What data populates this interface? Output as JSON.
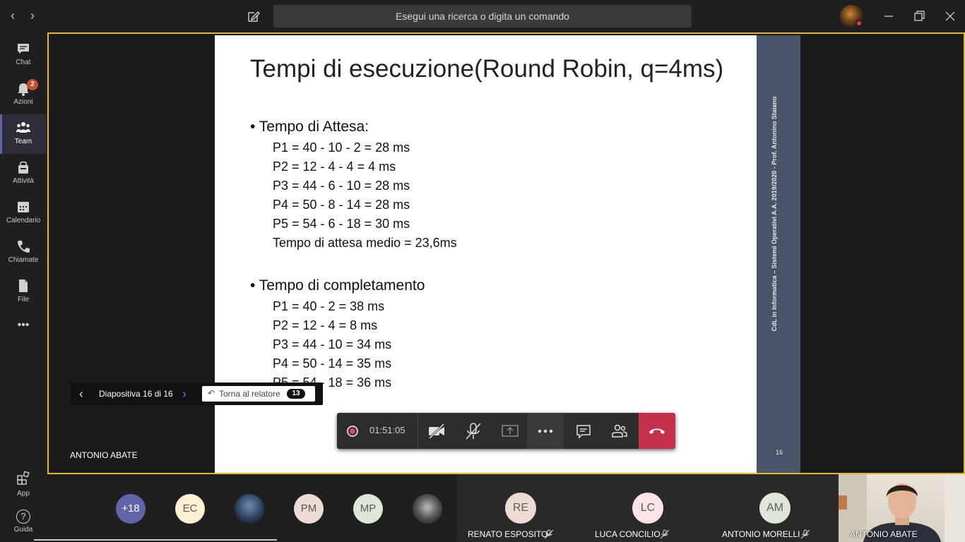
{
  "titlebar": {
    "search_placeholder": "Esegui una ricerca o digita un comando"
  },
  "rail": {
    "items": [
      {
        "label": "Chat",
        "icon": "chat-icon"
      },
      {
        "label": "Azioni",
        "icon": "bell-icon",
        "badge": "2"
      },
      {
        "label": "Team",
        "icon": "teams-icon"
      },
      {
        "label": "Attività",
        "icon": "bag-icon"
      },
      {
        "label": "Calendario",
        "icon": "calendar-icon"
      },
      {
        "label": "Chiamate",
        "icon": "phone-icon"
      },
      {
        "label": "File",
        "icon": "file-icon"
      }
    ],
    "more": "•••",
    "app_label": "App",
    "help_label": "Guida",
    "help_glyph": "?"
  },
  "slide": {
    "title": "Tempi di esecuzione(Round Robin, q=4ms)",
    "section1": "• Tempo di Attesa:",
    "wait_lines": [
      "P1 = 40 - 10 - 2 = 28 ms",
      "P2 = 12 - 4 -  4 = 4 ms",
      "P3 = 44 - 6 - 10 = 28 ms",
      "P4 = 50 - 8 - 14 = 28 ms",
      "P5 = 54 - 6 - 18 = 30 ms",
      "Tempo di attesa medio = 23,6ms"
    ],
    "section2": "• Tempo di completamento",
    "completion_lines": [
      "P1 = 40 - 2 = 38 ms",
      "P2 = 12 - 4 = 8 ms",
      "P3 = 44 - 10 = 34 ms",
      "P4 = 50 - 14 = 35 ms",
      "P5 = 54 - 18 = 36 ms"
    ],
    "sidebar_text": "CdL in Informatica – Sistemi Operativi  A.A. 2019/2020 - Prof. Antonino Staiano",
    "page_number": "16"
  },
  "presenter": {
    "name": "ANTONIO ABATE"
  },
  "slide_nav": {
    "counter": "Diapositiva 16 di 16",
    "back_label": "Torna al relatore",
    "back_count": "13"
  },
  "call": {
    "timer": "01:51:05",
    "accent_red": "#c4314b"
  },
  "gallery": {
    "overflow": "+18",
    "circles": [
      {
        "initials": "EC",
        "color": "#fdf0d2"
      },
      {
        "initials": "PM",
        "color": "#eddbd6"
      },
      {
        "initials": "MP",
        "color": "#dde6d9"
      }
    ],
    "tiles": [
      {
        "initials": "RE",
        "name": "RENATO ESPOSITO",
        "color": "#eddbd6"
      },
      {
        "initials": "LC",
        "name": "LUCA CONCILIO",
        "color": "#fbe3e6"
      },
      {
        "initials": "AM",
        "name": "ANTONIO MORELLI",
        "color": "#dde6d9"
      }
    ],
    "self_name": "ANTONIO ABATE"
  }
}
